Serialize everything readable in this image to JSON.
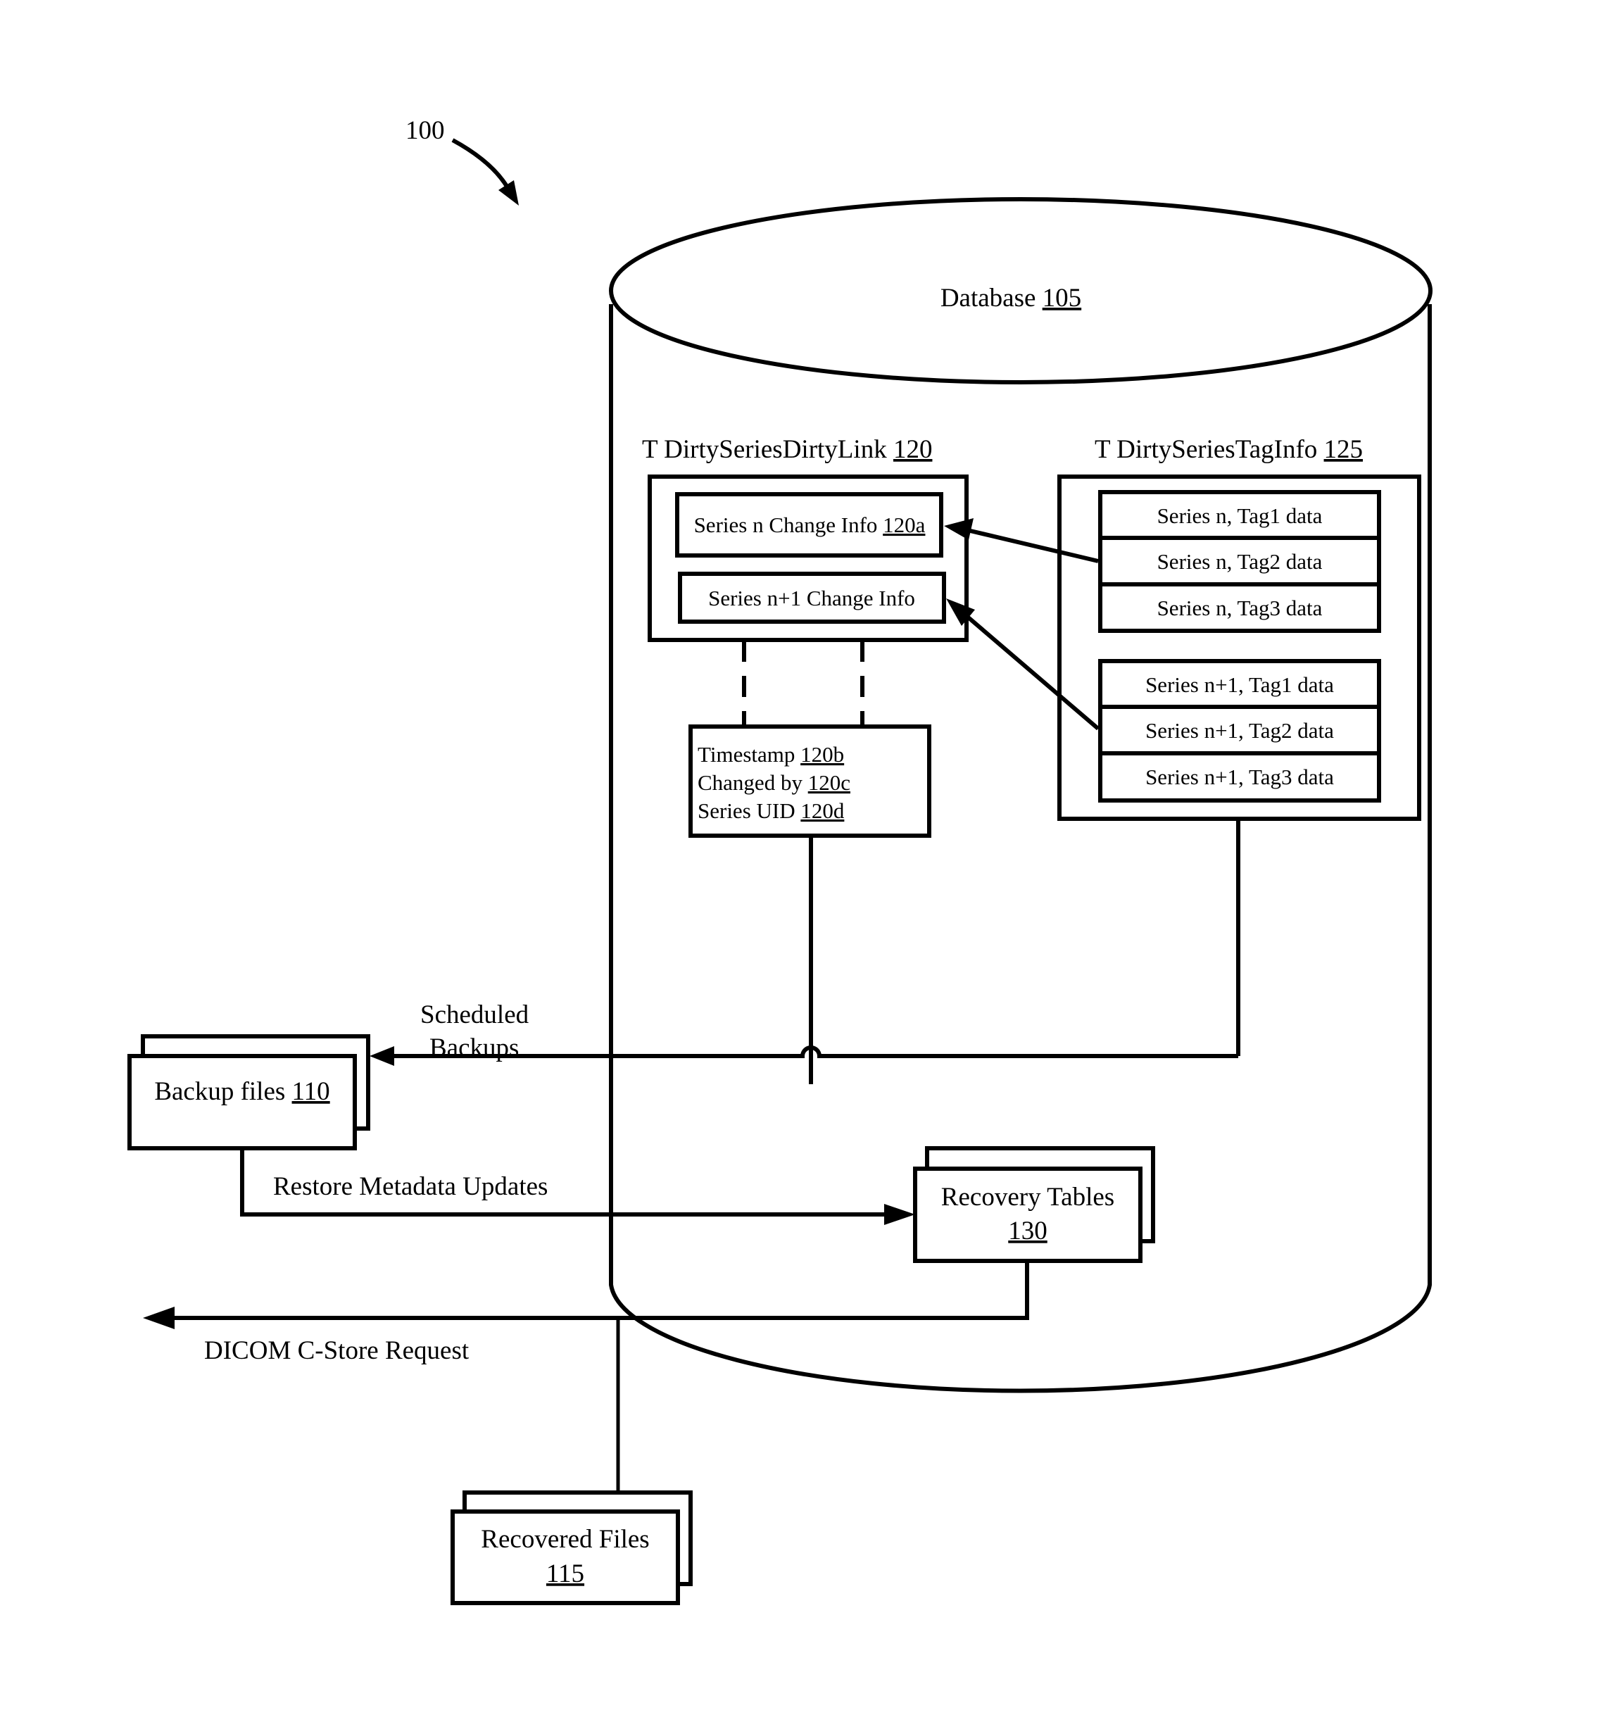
{
  "figure_ref": "100",
  "database": {
    "label": "Database",
    "ref": "105"
  },
  "dirty_link_table": {
    "label": "T DirtySeriesDirtyLink",
    "ref": "120",
    "rows": [
      {
        "label": "Series n Change Info",
        "ref": "120a"
      },
      {
        "label": "Series n+1 Change Info",
        "ref": ""
      }
    ],
    "detail_fields": [
      {
        "label": "Timestamp",
        "ref": "120b"
      },
      {
        "label": "Changed by",
        "ref": "120c"
      },
      {
        "label": "Series UID",
        "ref": "120d"
      }
    ]
  },
  "tag_info_table": {
    "label": "T DirtySeriesTagInfo",
    "ref": "125",
    "group_n": [
      "Series n, Tag1 data",
      "Series n, Tag2 data",
      "Series n, Tag3 data"
    ],
    "group_n1": [
      "Series n+1, Tag1 data",
      "Series n+1, Tag2 data",
      "Series n+1, Tag3 data"
    ]
  },
  "backup_files": {
    "label": "Backup files",
    "ref": "110"
  },
  "recovery_tables": {
    "label": "Recovery Tables",
    "ref": "130"
  },
  "recovered_files": {
    "label": "Recovered Files",
    "ref": "115"
  },
  "flows": {
    "scheduled_backups_1": "Scheduled",
    "scheduled_backups_2": "Backups",
    "restore": "Restore Metadata Updates",
    "dicom": "DICOM C-Store Request"
  }
}
